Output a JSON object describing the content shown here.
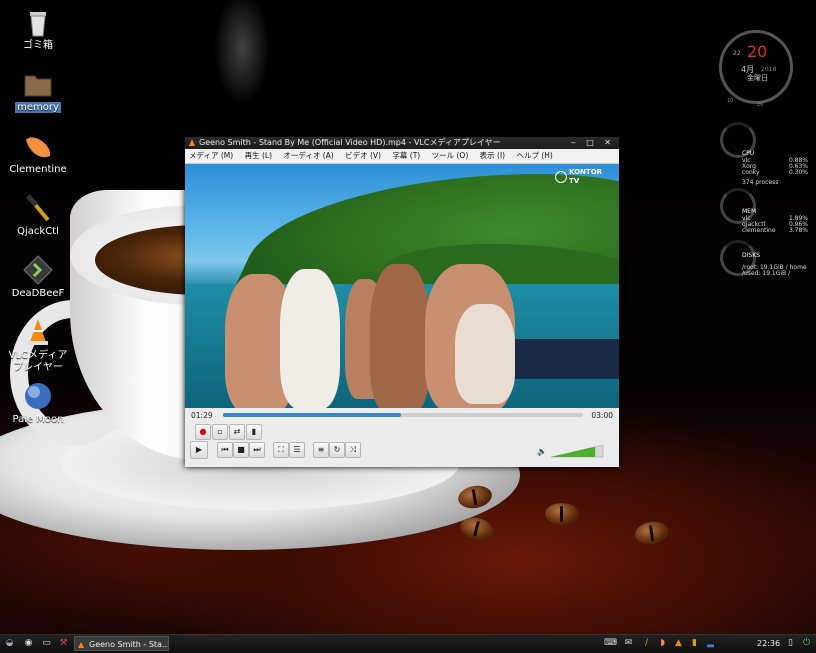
{
  "desktop": {
    "icons": [
      {
        "label": "ゴミ箱",
        "icon": "trash-icon"
      },
      {
        "label": "memory",
        "icon": "folder-icon"
      },
      {
        "label": "Clementine",
        "icon": "clementine-icon"
      },
      {
        "label": "QjackCtl",
        "icon": "qjackctl-icon"
      },
      {
        "label": "DeaDBeeF",
        "icon": "deadbeef-icon"
      },
      {
        "label": "VLCメディアプレイヤー",
        "icon": "vlc-cone-icon"
      },
      {
        "label": "Pale Moon",
        "icon": "palemoon-icon"
      }
    ]
  },
  "conky": {
    "clock": {
      "minute": "22",
      "day": "20",
      "month": "4月",
      "year": "2018",
      "weekday": "金曜日",
      "hour_label": "10",
      "second_label": "20"
    },
    "cpu": {
      "title": "CPU",
      "rows": [
        [
          "vlc",
          "0.88%"
        ],
        [
          "Xorg",
          "0.63%"
        ],
        [
          "conky",
          "0.30%"
        ]
      ],
      "procs": "374 process"
    },
    "mem": {
      "title": "MEM",
      "rows": [
        [
          "vlc",
          "1.89%"
        ],
        [
          "qjackctl",
          "0.96%"
        ],
        [
          "clementine",
          "3.78%"
        ]
      ]
    },
    "disks": {
      "title": "DISKS",
      "rows": [
        "/root: 19.1GiB  / home",
        "/used: 19.1GiB  / "
      ]
    }
  },
  "vlc": {
    "title": "Geeno Smith - Stand By Me (Official Video HD).mp4 - VLCメディアプレイヤー",
    "window_controls": "‒ □ ✕",
    "menu": [
      "メディア (M)",
      "再生 (L)",
      "オーディオ (A)",
      "ビデオ (V)",
      "字幕 (T)",
      "ツール (O)",
      "表示 (I)",
      "ヘルプ (H)"
    ],
    "video_logo": "KONTOR\nTV",
    "elapsed": "01:29",
    "total": "03:00",
    "progress": 0.494,
    "volume": 0.85,
    "accent": "#3a83d4"
  },
  "taskbar": {
    "task_label": "Geeno Smith - Sta...",
    "clock": "22:36"
  }
}
